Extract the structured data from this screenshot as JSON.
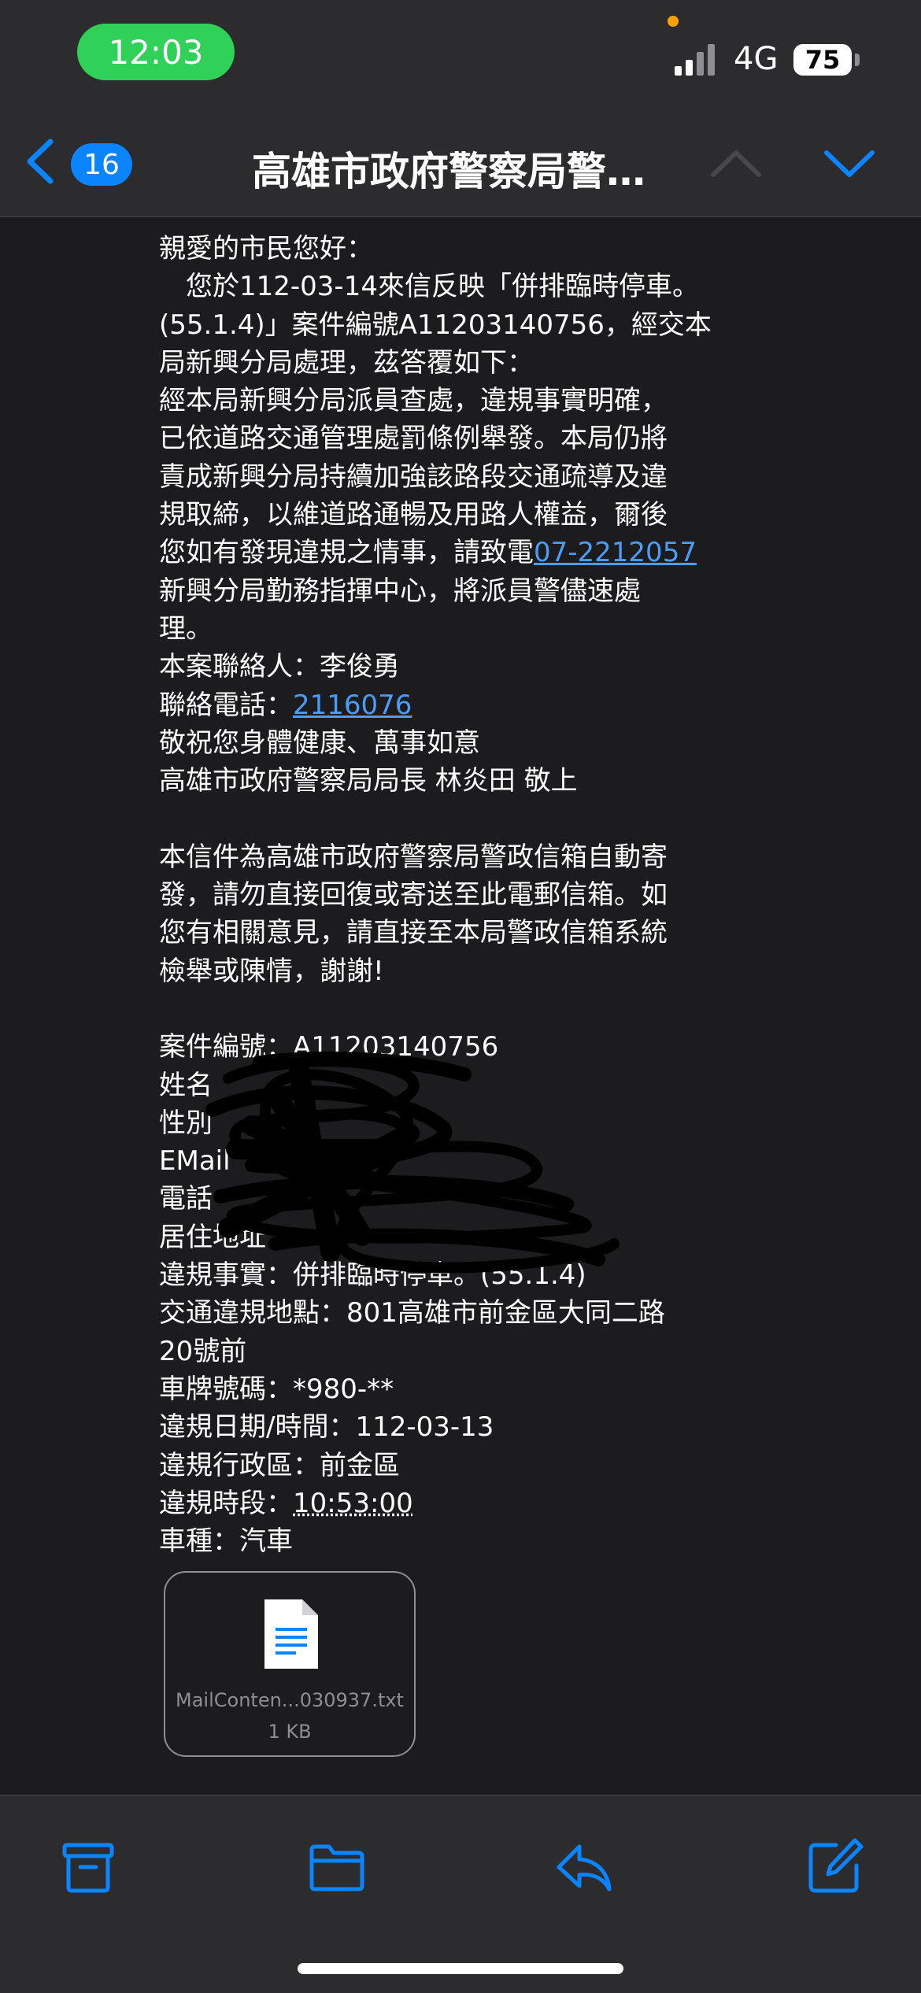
{
  "status_bar": {
    "time": "12:03",
    "network": "4G",
    "battery": "75"
  },
  "nav": {
    "unread_count": "16",
    "title": "高雄市政府警察局警…"
  },
  "body": {
    "lines": [
      "親愛的市民您好：",
      "　您於112-03-14來信反映「併排臨時停車。",
      "(55.1.4)」案件編號A11203140756，經交本",
      "局新興分局處理，茲答覆如下：",
      "經本局新興分局派員查處，違規事實明確，",
      "已依道路交通管理處罰條例舉發。本局仍將",
      "責成新興分局持續加強該路段交通疏導及違",
      "規取締，以維道路通暢及用路人權益，爾後"
    ],
    "report_prefix": "您如有發現違規之情事，請致電",
    "report_phone": "07-2212057",
    "lines2": [
      "新興分局勤務指揮中心，將派員警儘速處",
      "理。",
      "本案聯絡人：李俊勇"
    ],
    "contact_phone_label": "聯絡電話：",
    "contact_phone": "2116076",
    "lines3": [
      "敬祝您身體健康、萬事如意",
      "高雄市政府警察局局長 林炎田 敬上"
    ],
    "notice": [
      "本信件為高雄市政府警察局警政信箱自動寄",
      "發，請勿直接回復或寄送至此電郵信箱。如",
      "您有相關意見，請直接至本局警政信箱系統",
      "檢舉或陳情，謝謝!"
    ],
    "details": [
      "案件編號：A11203140756",
      "姓名",
      "性別",
      "EMail",
      "電話",
      "居住地址",
      "違規事實：併排臨時停車。(55.1.4)",
      "交通違規地點：801高雄市前金區大同二路",
      "20號前",
      "車牌號碼：*980-**",
      "違規日期/時間：112-03-13",
      "違規行政區：前金區"
    ],
    "period_label": "違規時段：",
    "period_value": "10:53:00",
    "vehicle": "車種：汽車"
  },
  "attachment": {
    "name": "MailConten...030937.txt",
    "size": "1 KB"
  },
  "colors": {
    "accent": "#0a84ff",
    "link": "#4a9df8",
    "background": "#1c1c1e",
    "time_pill": "#30d158"
  }
}
